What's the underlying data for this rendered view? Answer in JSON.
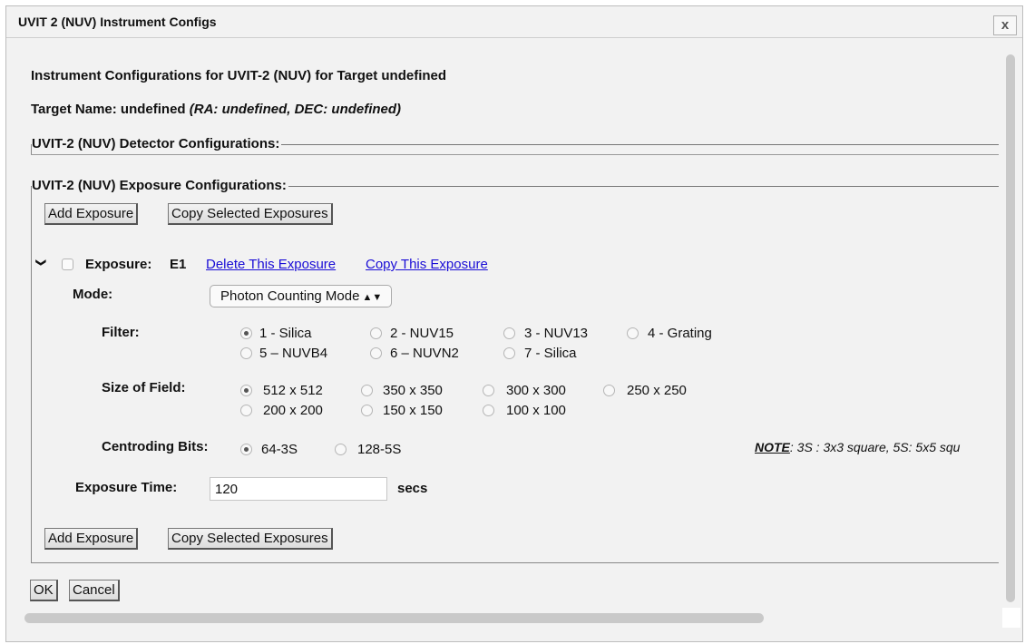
{
  "dialog": {
    "title": "UVIT 2 (NUV) Instrument Configs",
    "close_label": "x"
  },
  "headings": {
    "main": "Instrument Configurations for UVIT-2 (NUV) for Target undefined",
    "target_label": "Target Name: undefined",
    "target_coords": "(RA: undefined, DEC: undefined)"
  },
  "detector": {
    "legend": "UVIT-2 (NUV) Detector Configurations:"
  },
  "exposure_section": {
    "legend": "UVIT-2 (NUV) Exposure Configurations:",
    "add_label": "Add Exposure",
    "copy_selected_label": "Copy Selected Exposures"
  },
  "exposure": {
    "toggle": "❯",
    "label": "Exposure:",
    "id": "E1",
    "delete_link": "Delete This Exposure",
    "copy_link": "Copy This Exposure",
    "mode_label": "Mode:",
    "mode_value": "Photon Counting Mode",
    "filter_label": "Filter:",
    "filters": [
      "1 - Silica",
      "2 - NUV15",
      "3 - NUV13",
      "4 - Grating",
      "5 – NUVB4",
      "6 – NUVN2",
      "7 - Silica"
    ],
    "filter_selected": 0,
    "size_label": "Size of Field:",
    "sizes": [
      "512 x 512",
      "350 x 350",
      "300 x 300",
      "250 x 250",
      "200 x 200",
      "150 x 150",
      "100 x 100"
    ],
    "size_selected": 0,
    "centroid_label": "Centroding Bits:",
    "centroids": [
      "64-3S",
      "128-5S"
    ],
    "centroid_selected": 0,
    "note_label": "NOTE",
    "note_text": ": 3S : 3x3 square, 5S: 5x5 squ",
    "time_label": "Exposure Time:",
    "time_value": "120",
    "time_unit": "secs"
  },
  "footer": {
    "ok_label": "OK",
    "cancel_label": "Cancel"
  },
  "colors": {
    "link": "#1a0dd6",
    "background": "#f2f2f2"
  }
}
